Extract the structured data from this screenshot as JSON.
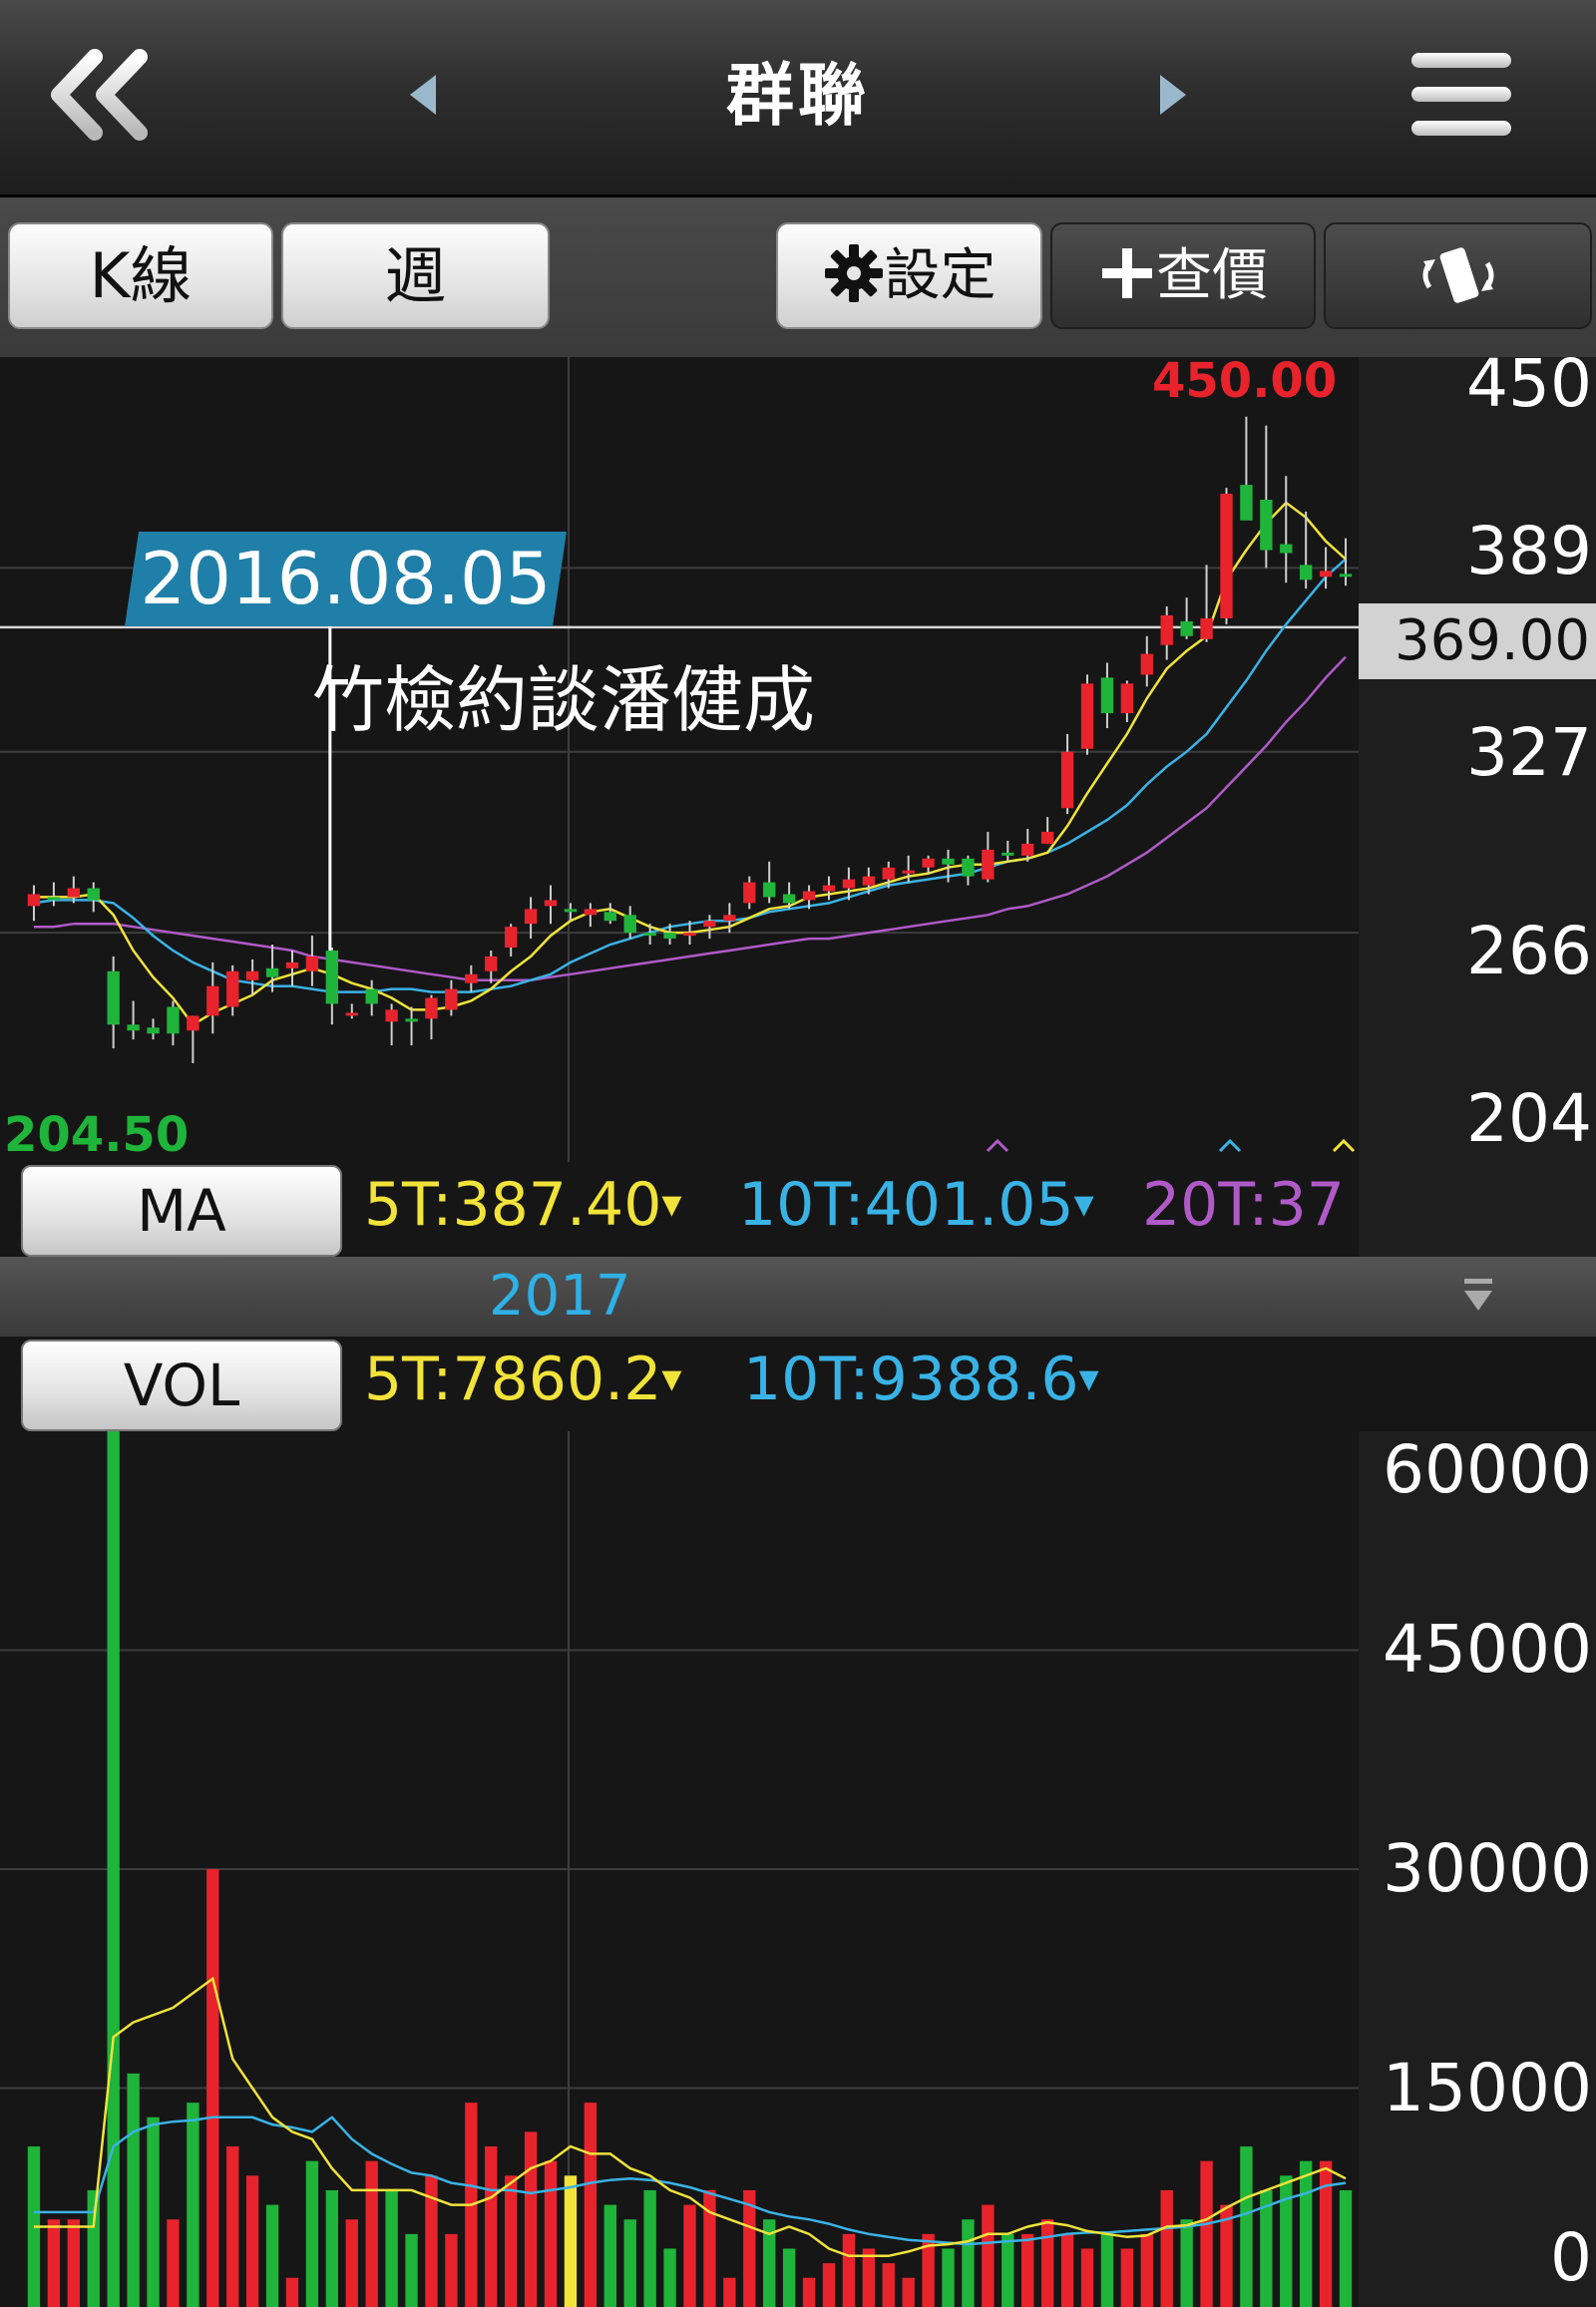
{
  "header": {
    "title": "群聯",
    "back_icon": "double-chevron-left-icon",
    "prev_icon": "triangle-left-icon",
    "next_icon": "triangle-right-icon",
    "menu_icon": "hamburger-menu-icon"
  },
  "toolbar": {
    "kline_label": "K線",
    "period_label": "週",
    "settings_label": "設定",
    "quote_label": "查價",
    "rotate_icon": "rotate-screen-icon"
  },
  "price_chart": {
    "high_label": "450.00",
    "low_label": "204.50",
    "current_price": "369.00",
    "y_ticks": [
      "450",
      "389",
      "327",
      "266",
      "204"
    ],
    "annotation_date": "2016.08.05",
    "annotation_text": "竹檢約談潘健成"
  },
  "ma_legend": {
    "button": "MA",
    "ma5": "5T:387.40",
    "ma10": "10T:401.05",
    "ma20": "20T:37"
  },
  "year_label": "2017",
  "vol_legend": {
    "button": "VOL",
    "ma5": "5T:7860.2",
    "ma10": "10T:9388.6"
  },
  "volume_chart": {
    "y_ticks": [
      "60000",
      "45000",
      "30000",
      "15000",
      "0"
    ]
  },
  "colors": {
    "up": "#e8232c",
    "down": "#1fb43a",
    "ma5": "#f2e33a",
    "ma10": "#39b3e6",
    "ma20": "#b05ac8",
    "high_label": "#e8232c",
    "low_label": "#1fb43a",
    "annotation_bg": "#1f7fa8"
  },
  "chart_data": {
    "type": "candlestick",
    "period": "weekly",
    "ylim": [
      204.5,
      450
    ],
    "ohlc": [
      [
        275,
        282,
        270,
        279
      ],
      [
        278,
        283,
        275,
        277
      ],
      [
        278,
        285,
        276,
        281
      ],
      [
        281,
        283,
        273,
        277
      ],
      [
        253,
        258,
        227,
        235
      ],
      [
        235,
        243,
        230,
        233
      ],
      [
        234,
        237,
        230,
        232
      ],
      [
        241,
        243,
        228,
        232
      ],
      [
        233,
        238,
        222,
        238
      ],
      [
        238,
        256,
        232,
        248
      ],
      [
        241,
        255,
        238,
        253
      ],
      [
        250,
        257,
        245,
        253
      ],
      [
        254,
        262,
        246,
        251
      ],
      [
        254,
        260,
        248,
        256
      ],
      [
        253,
        265,
        248,
        258
      ],
      [
        260,
        261,
        235,
        242
      ],
      [
        239,
        242,
        237,
        239
      ],
      [
        247,
        250,
        238,
        242
      ],
      [
        236,
        242,
        228,
        240
      ],
      [
        237,
        241,
        228,
        236
      ],
      [
        237,
        245,
        230,
        244
      ],
      [
        240,
        250,
        238,
        247
      ],
      [
        249,
        255,
        246,
        252
      ],
      [
        253,
        260,
        249,
        258
      ],
      [
        261,
        269,
        258,
        268
      ],
      [
        269,
        278,
        264,
        274
      ],
      [
        275,
        282,
        269,
        277
      ],
      [
        274,
        276,
        270,
        273
      ],
      [
        272,
        276,
        268,
        274
      ],
      [
        273,
        276,
        269,
        270
      ],
      [
        272,
        275,
        264,
        266
      ],
      [
        266,
        269,
        262,
        265
      ],
      [
        266,
        269,
        262,
        264
      ],
      [
        266,
        270,
        262,
        266
      ],
      [
        268,
        272,
        264,
        270
      ],
      [
        270,
        276,
        266,
        272
      ],
      [
        276,
        285,
        274,
        283
      ],
      [
        283,
        290,
        276,
        278
      ],
      [
        279,
        283,
        274,
        276
      ],
      [
        277,
        282,
        274,
        280
      ],
      [
        280,
        285,
        277,
        282
      ],
      [
        281,
        288,
        277,
        284
      ],
      [
        282,
        288,
        279,
        285
      ],
      [
        284,
        290,
        281,
        288
      ],
      [
        286,
        292,
        283,
        287
      ],
      [
        288,
        292,
        286,
        291
      ],
      [
        291,
        294,
        283,
        289
      ],
      [
        291,
        292,
        282,
        285
      ],
      [
        284,
        300,
        283,
        294
      ],
      [
        293,
        297,
        290,
        292
      ],
      [
        292,
        301,
        290,
        296
      ],
      [
        296,
        305,
        296,
        300
      ],
      [
        308,
        333,
        306,
        327
      ],
      [
        328,
        353,
        326,
        350
      ],
      [
        352,
        357,
        335,
        340
      ],
      [
        340,
        351,
        337,
        350
      ],
      [
        353,
        366,
        349,
        360
      ],
      [
        363,
        376,
        358,
        373
      ],
      [
        371,
        379,
        365,
        366
      ],
      [
        365,
        390,
        364,
        372
      ],
      [
        372,
        416,
        370,
        414
      ],
      [
        417,
        440,
        407,
        405
      ],
      [
        412,
        437,
        389,
        395
      ],
      [
        397,
        420,
        384,
        394
      ],
      [
        390,
        408,
        382,
        385
      ],
      [
        386,
        396,
        382,
        388
      ],
      [
        387,
        399,
        383,
        386
      ]
    ],
    "ma5": [
      278,
      278,
      278,
      279,
      272,
      260,
      251,
      244,
      235,
      239,
      242,
      245,
      250,
      252,
      254,
      252,
      249,
      247,
      244,
      240,
      240,
      241,
      243,
      247,
      253,
      258,
      265,
      270,
      273,
      274,
      271,
      268,
      266,
      266,
      267,
      268,
      271,
      274,
      275,
      278,
      279,
      280,
      281,
      283,
      285,
      286,
      288,
      289,
      289,
      290,
      291,
      293,
      302,
      313,
      323,
      333,
      345,
      355,
      361,
      366,
      385,
      395,
      404,
      411,
      406,
      398,
      392
    ],
    "ma10": [
      276,
      277,
      277,
      277,
      276,
      271,
      265,
      260,
      256,
      253,
      250,
      249,
      248,
      248,
      247,
      246,
      246,
      246,
      247,
      247,
      246,
      246,
      246,
      247,
      248,
      250,
      252,
      256,
      259,
      262,
      264,
      266,
      268,
      269,
      270,
      270,
      271,
      273,
      274,
      275,
      276,
      278,
      280,
      282,
      283,
      284,
      285,
      286,
      288,
      290,
      291,
      293,
      296,
      300,
      304,
      309,
      316,
      322,
      327,
      333,
      342,
      351,
      361,
      370,
      378,
      386,
      392
    ],
    "ma20": [
      268,
      268,
      269,
      269,
      269,
      268,
      267,
      266,
      265,
      264,
      263,
      262,
      261,
      260,
      258,
      257,
      256,
      255,
      254,
      253,
      252,
      251,
      250,
      250,
      250,
      250,
      251,
      252,
      253,
      254,
      255,
      256,
      257,
      258,
      259,
      260,
      261,
      262,
      263,
      264,
      264,
      265,
      266,
      267,
      268,
      269,
      270,
      271,
      272,
      274,
      275,
      277,
      279,
      282,
      285,
      289,
      293,
      298,
      303,
      308,
      315,
      322,
      329,
      337,
      344,
      352,
      359
    ],
    "volume": {
      "ylim": [
        0,
        60000
      ],
      "values": [
        11000,
        6000,
        6000,
        8000,
        60000,
        16000,
        13000,
        6000,
        14000,
        30000,
        11000,
        9000,
        7000,
        2000,
        10000,
        8000,
        6000,
        10000,
        8000,
        5000,
        9000,
        5000,
        14000,
        11000,
        9000,
        12000,
        10000,
        9000,
        14000,
        7000,
        6000,
        8000,
        4000,
        7000,
        8000,
        2000,
        8000,
        6000,
        4000,
        2000,
        3000,
        5000,
        4000,
        3000,
        2000,
        5000,
        4000,
        6000,
        7000,
        5000,
        5000,
        6000,
        5000,
        4000,
        5000,
        4000,
        5000,
        8000,
        6000,
        10000,
        7000,
        11000,
        8000,
        9000,
        10000,
        10000,
        8000
      ],
      "up": [
        0,
        1,
        1,
        0,
        0,
        0,
        0,
        1,
        0,
        1,
        1,
        1,
        0,
        1,
        0,
        0,
        1,
        1,
        0,
        0,
        1,
        1,
        1,
        1,
        1,
        1,
        1,
        0,
        1,
        0,
        0,
        0,
        0,
        1,
        1,
        1,
        1,
        0,
        0,
        1,
        1,
        1,
        1,
        1,
        1,
        1,
        0,
        0,
        1,
        0,
        1,
        1,
        1,
        1,
        0,
        1,
        1,
        1,
        0,
        1,
        1,
        0,
        0,
        0,
        0,
        1,
        0
      ],
      "ma5": [
        5500,
        5500,
        5500,
        5500,
        18500,
        19500,
        20000,
        20500,
        21500,
        22500,
        17000,
        15000,
        13000,
        12000,
        11500,
        9500,
        8000,
        8000,
        8000,
        8000,
        7500,
        7000,
        7000,
        7500,
        8500,
        9500,
        10000,
        11000,
        10500,
        10500,
        9500,
        9000,
        8000,
        7500,
        6500,
        6000,
        5500,
        5000,
        5500,
        5000,
        4000,
        3500,
        3500,
        3500,
        3800,
        4200,
        4300,
        4500,
        5000,
        5000,
        5500,
        5800,
        5600,
        5200,
        5000,
        4800,
        4900,
        5500,
        5600,
        6000,
        6800,
        7500,
        8000,
        8500,
        9000,
        9500,
        8800
      ],
      "ma10": [
        6500,
        6500,
        6500,
        6500,
        11000,
        12000,
        12500,
        12700,
        12800,
        13000,
        13000,
        13000,
        12500,
        12300,
        12000,
        13000,
        11500,
        10500,
        9800,
        9200,
        9000,
        8500,
        8300,
        8000,
        8000,
        7800,
        8000,
        8200,
        8500,
        8700,
        8800,
        8700,
        8500,
        8200,
        7800,
        7400,
        7000,
        6500,
        6200,
        6000,
        5700,
        5300,
        5000,
        4800,
        4600,
        4500,
        4400,
        4300,
        4400,
        4500,
        4600,
        4800,
        5000,
        5100,
        5100,
        5200,
        5300,
        5400,
        5500,
        5700,
        6000,
        6400,
        6900,
        7400,
        7800,
        8300,
        8500
      ]
    }
  }
}
